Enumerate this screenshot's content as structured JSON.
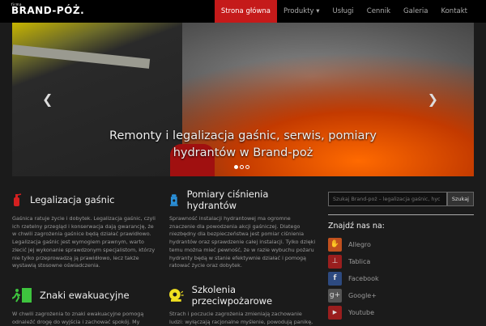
{
  "nav": {
    "logo_top": "firma",
    "logo": "BRAND-PÓŻ.",
    "items": [
      "Strona główna",
      "Produkty ▾",
      "Usługi",
      "Cennik",
      "Galeria",
      "Kontakt"
    ]
  },
  "hero": {
    "caption_line1": "Remonty i legalizacja gaśnic, serwis, pomiary",
    "caption_line2": "hydrantów w Brand-poż",
    "slides": 3,
    "active_slide": 1
  },
  "features": [
    {
      "title": "Legalizacja gaśnic",
      "icon": "fire-extinguisher-icon",
      "color": "#d42020",
      "text": "Gaśnica ratuje życie i dobytek. Legalizacja gaśnic, czyli ich rzetelny przegląd i konserwacja dają gwarancję, że w chwili zagrożenia gaśnice będą działać prawidłowo. Legalizacja gaśnic jest wymogiem prawnym, warto zlecić jej wykonanie sprawdzonym specjalistom, którzy nie tylko przeprowadzą ją prawidłowo, lecz także wystawią stosowne oświadczenia."
    },
    {
      "title": "Pomiary ciśnienia hydrantów",
      "icon": "hydrant-icon",
      "color": "#2a8fd8",
      "text": "Sprawność instalacji hydrantowej ma ogromne znaczenie dla powodzenia akcji gaśniczej. Dlatego niezbędny dla bezpieczeństwa jest pomiar ciśnienia hydrantów oraz sprawdzenie całej instalacji. Tylko dzięki temu można mieć pewność, że w razie wybuchu pożaru hydranty będą w stanie efektywnie działać i pomogą ratować życie oraz dobytek."
    },
    {
      "title": "Znaki ewakuacyjne",
      "icon": "exit-sign-icon",
      "color": "#3ec43e",
      "text": "W chwili zagrożenia to znaki ewakuacyjne pomogą odnaleźć drogę do wyjścia i zachować spokój. My"
    },
    {
      "title": "Szkolenia przeciwpożarowe",
      "icon": "alarm-bell-icon",
      "color": "#f0e020",
      "text": "Strach i poczucie zagrożenia zmieniają zachowanie ludzi: wyłączają racjonalne myślenie, powodują panikę,"
    }
  ],
  "sidebar": {
    "search_placeholder": "Szukaj Brand-poż – legalizacja gaśnic, hyc",
    "search_button": "Szukaj",
    "find_us": "Znajdź nas na:",
    "social": [
      {
        "label": "Allegro",
        "glyph": "✋",
        "color": "#c0501e"
      },
      {
        "label": "Tablica",
        "glyph": "📌",
        "color": "#9a1e1e"
      },
      {
        "label": "Facebook",
        "glyph": "f",
        "color": "#2d4a80"
      },
      {
        "label": "Google+",
        "glyph": "g+",
        "color": "#555"
      },
      {
        "label": "Youtube",
        "glyph": "▶",
        "color": "#9a1e1e"
      }
    ]
  }
}
